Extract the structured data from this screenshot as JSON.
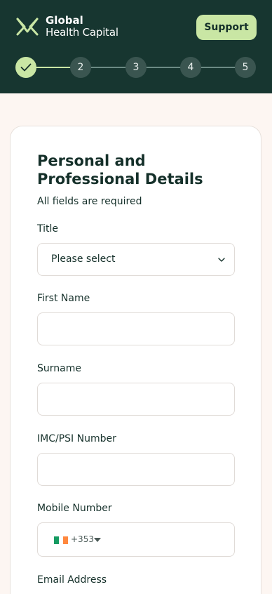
{
  "header": {
    "logo_line1": "Global",
    "logo_line2": "Health Capital",
    "support_label": "Support",
    "steps": [
      {
        "label": "",
        "state": "complete"
      },
      {
        "label": "2",
        "state": "pending"
      },
      {
        "label": "3",
        "state": "pending"
      },
      {
        "label": "4",
        "state": "pending"
      },
      {
        "label": "5",
        "state": "pending"
      }
    ]
  },
  "form": {
    "title": "Personal and Professional Details",
    "subtitle": "All fields are required",
    "title_field": {
      "label": "Title",
      "selected": "Please select"
    },
    "first_name": {
      "label": "First Name",
      "value": ""
    },
    "surname": {
      "label": "Surname",
      "value": ""
    },
    "imc_psi": {
      "label": "IMC/PSI Number",
      "value": ""
    },
    "mobile": {
      "label": "Mobile Number",
      "country_code": "+353",
      "country_flag": "ireland-flag-icon",
      "value": ""
    },
    "email": {
      "label": "Email Address"
    }
  },
  "colors": {
    "header_bg": "#173630",
    "accent": "#c9e6a4",
    "page_bg": "#fdf6f2",
    "text": "#15302a"
  }
}
